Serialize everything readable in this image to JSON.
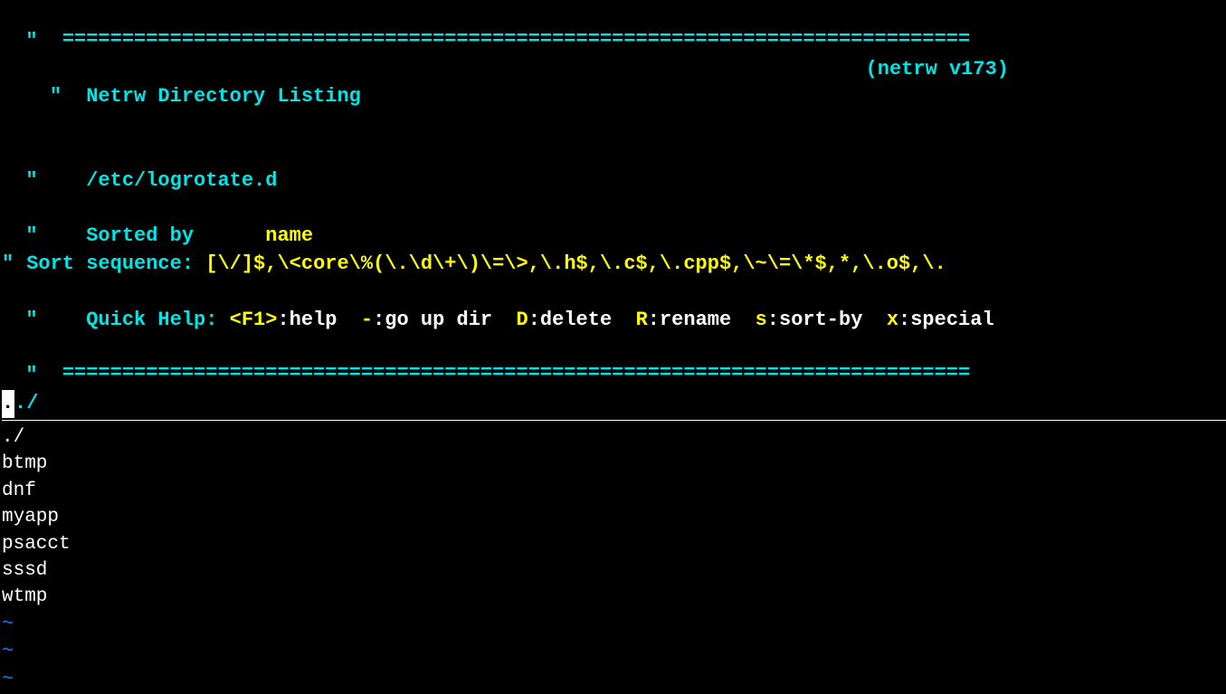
{
  "header": {
    "rule": "============================================================================",
    "title": "Netrw Directory Listing",
    "version": "(netrw v173)",
    "path": "/etc/logrotate.d",
    "sorted_by_label": "Sorted by",
    "sorted_by_value": "name",
    "sort_seq_label": "Sort sequence:",
    "sort_seq_value": "[\\/]$,\\<core\\%(\\.\\d\\+\\)\\=\\>,\\.h$,\\.c$,\\.cpp$,\\~\\=\\*$,*,\\.o$,\\.",
    "help_label": "Quick Help:",
    "help_f1": "<F1>",
    "help_f1_desc": ":help",
    "help_dash": "-",
    "help_dash_desc": ":go up dir",
    "help_d": "D",
    "help_d_desc": ":delete",
    "help_r": "R",
    "help_r_desc": ":rename",
    "help_s": "s",
    "help_s_desc": ":sort-by",
    "help_x": "x",
    "help_x_desc": ":special"
  },
  "current_dir": "./",
  "entries": [
    "./",
    "btmp",
    "dnf",
    "myapp",
    "psacct",
    "sssd",
    "wtmp"
  ],
  "tilde": "~"
}
